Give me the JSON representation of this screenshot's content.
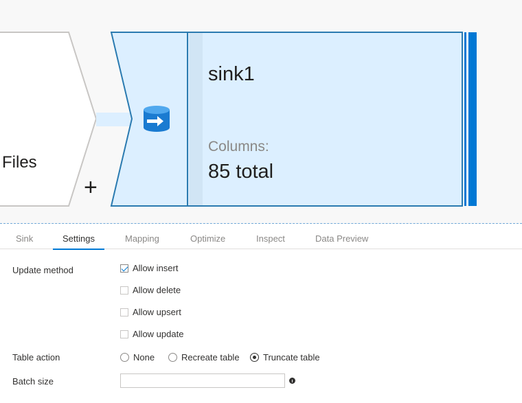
{
  "canvas": {
    "source_node": {
      "label": "Files"
    },
    "add_label": "+",
    "sink_node": {
      "name": "sink1",
      "columns_label": "Columns:",
      "columns_total": "85 total",
      "icon": "database-arrow-icon"
    }
  },
  "tabs": [
    {
      "label": "Sink"
    },
    {
      "label": "Settings",
      "active": true
    },
    {
      "label": "Mapping"
    },
    {
      "label": "Optimize"
    },
    {
      "label": "Inspect"
    },
    {
      "label": "Data Preview"
    }
  ],
  "settings": {
    "update_method": {
      "label": "Update method",
      "options": [
        {
          "label": "Allow insert",
          "checked": true
        },
        {
          "label": "Allow delete",
          "checked": false
        },
        {
          "label": "Allow upsert",
          "checked": false
        },
        {
          "label": "Allow update",
          "checked": false
        }
      ]
    },
    "table_action": {
      "label": "Table action",
      "options": [
        {
          "label": "None",
          "selected": false
        },
        {
          "label": "Recreate table",
          "selected": false
        },
        {
          "label": "Truncate table",
          "selected": true
        }
      ]
    },
    "batch_size": {
      "label": "Batch size",
      "value": "",
      "icon": "info-icon"
    }
  },
  "colors": {
    "accent": "#0078d4",
    "node_fill": "#dcefff",
    "node_border": "#2a7ab0"
  }
}
